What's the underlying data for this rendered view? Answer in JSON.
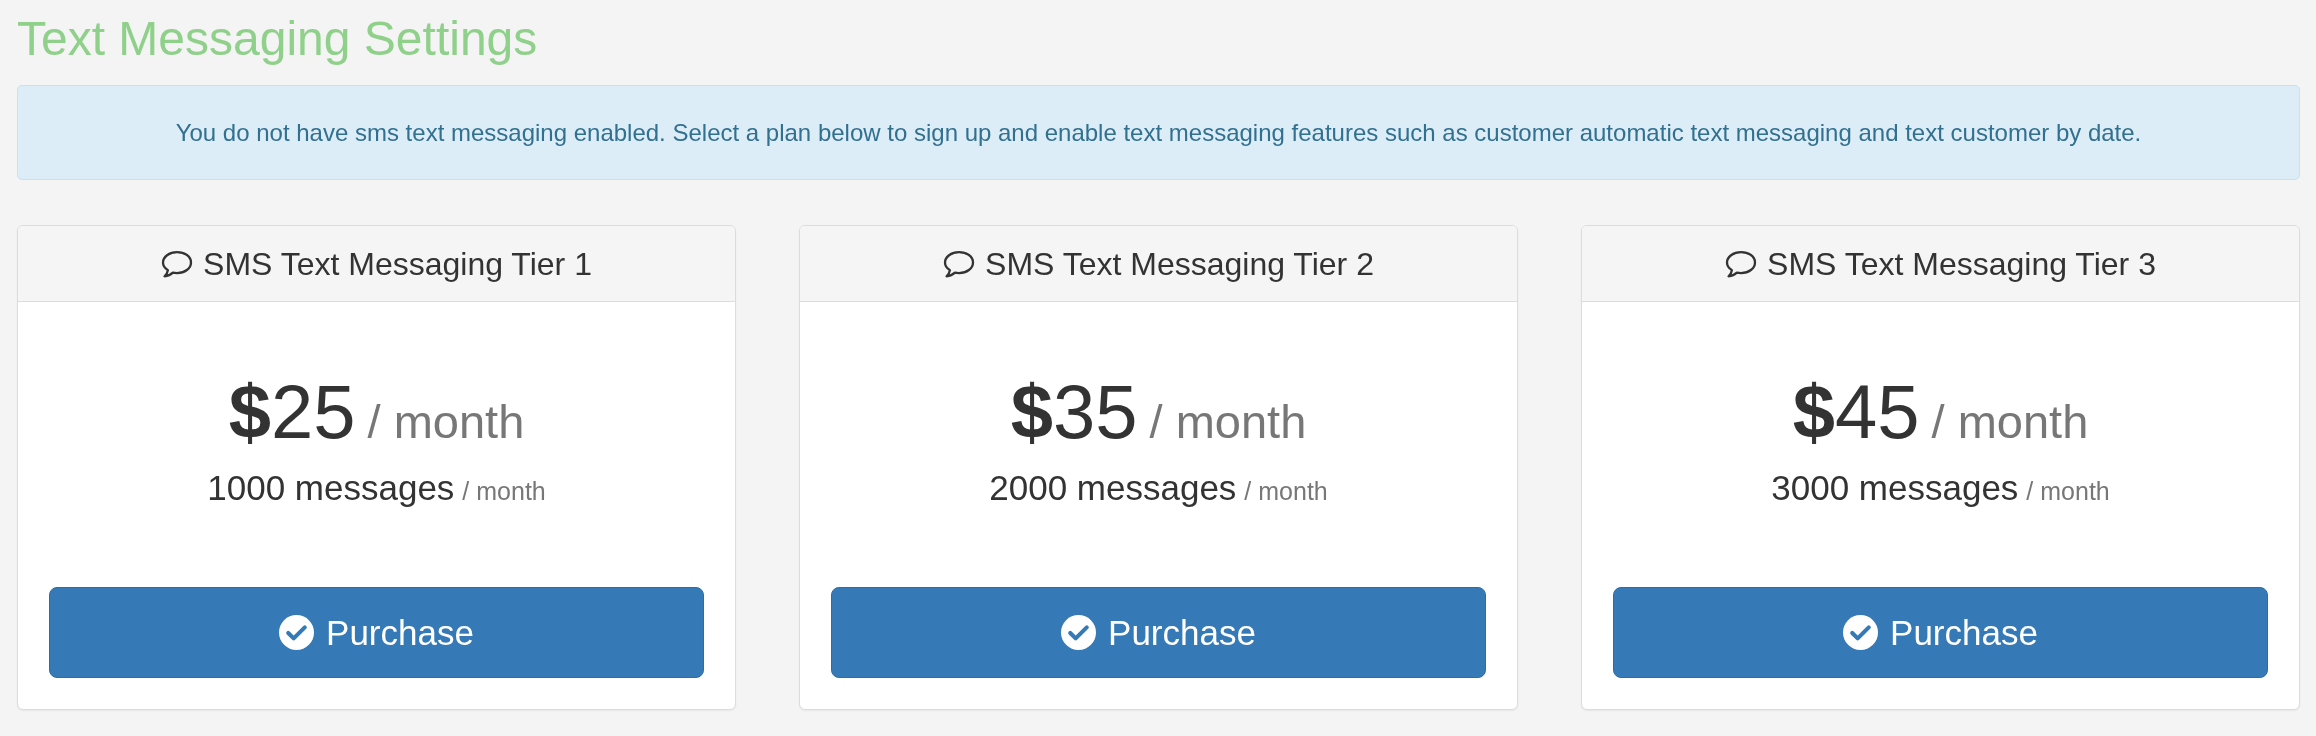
{
  "page": {
    "title": "Text Messaging Settings"
  },
  "alert": {
    "text": "You do not have sms text messaging enabled. Select a plan below to sign up and enable text messaging features such as customer automatic text messaging and text customer by date."
  },
  "plans": [
    {
      "title": "SMS Text Messaging Tier 1",
      "price": "**$**25",
      "price_period": "/ month",
      "messages": "1000 messages",
      "messages_period": "/ month",
      "button": "Purchase"
    },
    {
      "title": "SMS Text Messaging Tier 2",
      "price": "**$**35",
      "price_period": "/ month",
      "messages": "2000 messages",
      "messages_period": "/ month",
      "button": "Purchase"
    },
    {
      "title": "SMS Text Messaging Tier 3",
      "price": "**$**45",
      "price_period": "/ month",
      "messages": "3000 messages",
      "messages_period": "/ month",
      "button": "Purchase"
    }
  ]
}
